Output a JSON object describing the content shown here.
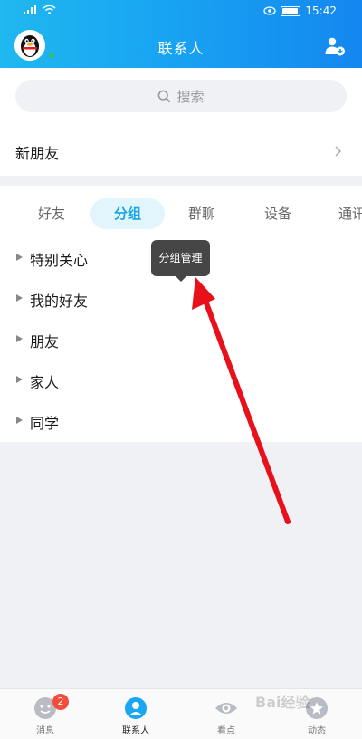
{
  "status_bar": {
    "signal": "4G",
    "time": "15:42"
  },
  "header": {
    "title": "联系人"
  },
  "search": {
    "placeholder": "搜索"
  },
  "new_friends": {
    "label": "新朋友"
  },
  "tabs": [
    {
      "label": "好友"
    },
    {
      "label": "分组"
    },
    {
      "label": "群聊"
    },
    {
      "label": "设备"
    },
    {
      "label": "通讯"
    }
  ],
  "active_tab": "分组",
  "groups": [
    {
      "label": "特别关心"
    },
    {
      "label": "我的好友"
    },
    {
      "label": "朋友"
    },
    {
      "label": "家人"
    },
    {
      "label": "同学"
    }
  ],
  "tooltip": {
    "label": "分组管理"
  },
  "bottom_nav": [
    {
      "label": "消息",
      "badge": "2"
    },
    {
      "label": "联系人"
    },
    {
      "label": "看点"
    },
    {
      "label": "动态"
    }
  ],
  "watermark": {
    "text": "Bai经验"
  },
  "colors": {
    "header_start": "#20b8f0",
    "header_end": "#1487f0",
    "accent": "#17a6e8",
    "badge": "#f24d3c",
    "annotation_arrow": "#e8101a"
  }
}
